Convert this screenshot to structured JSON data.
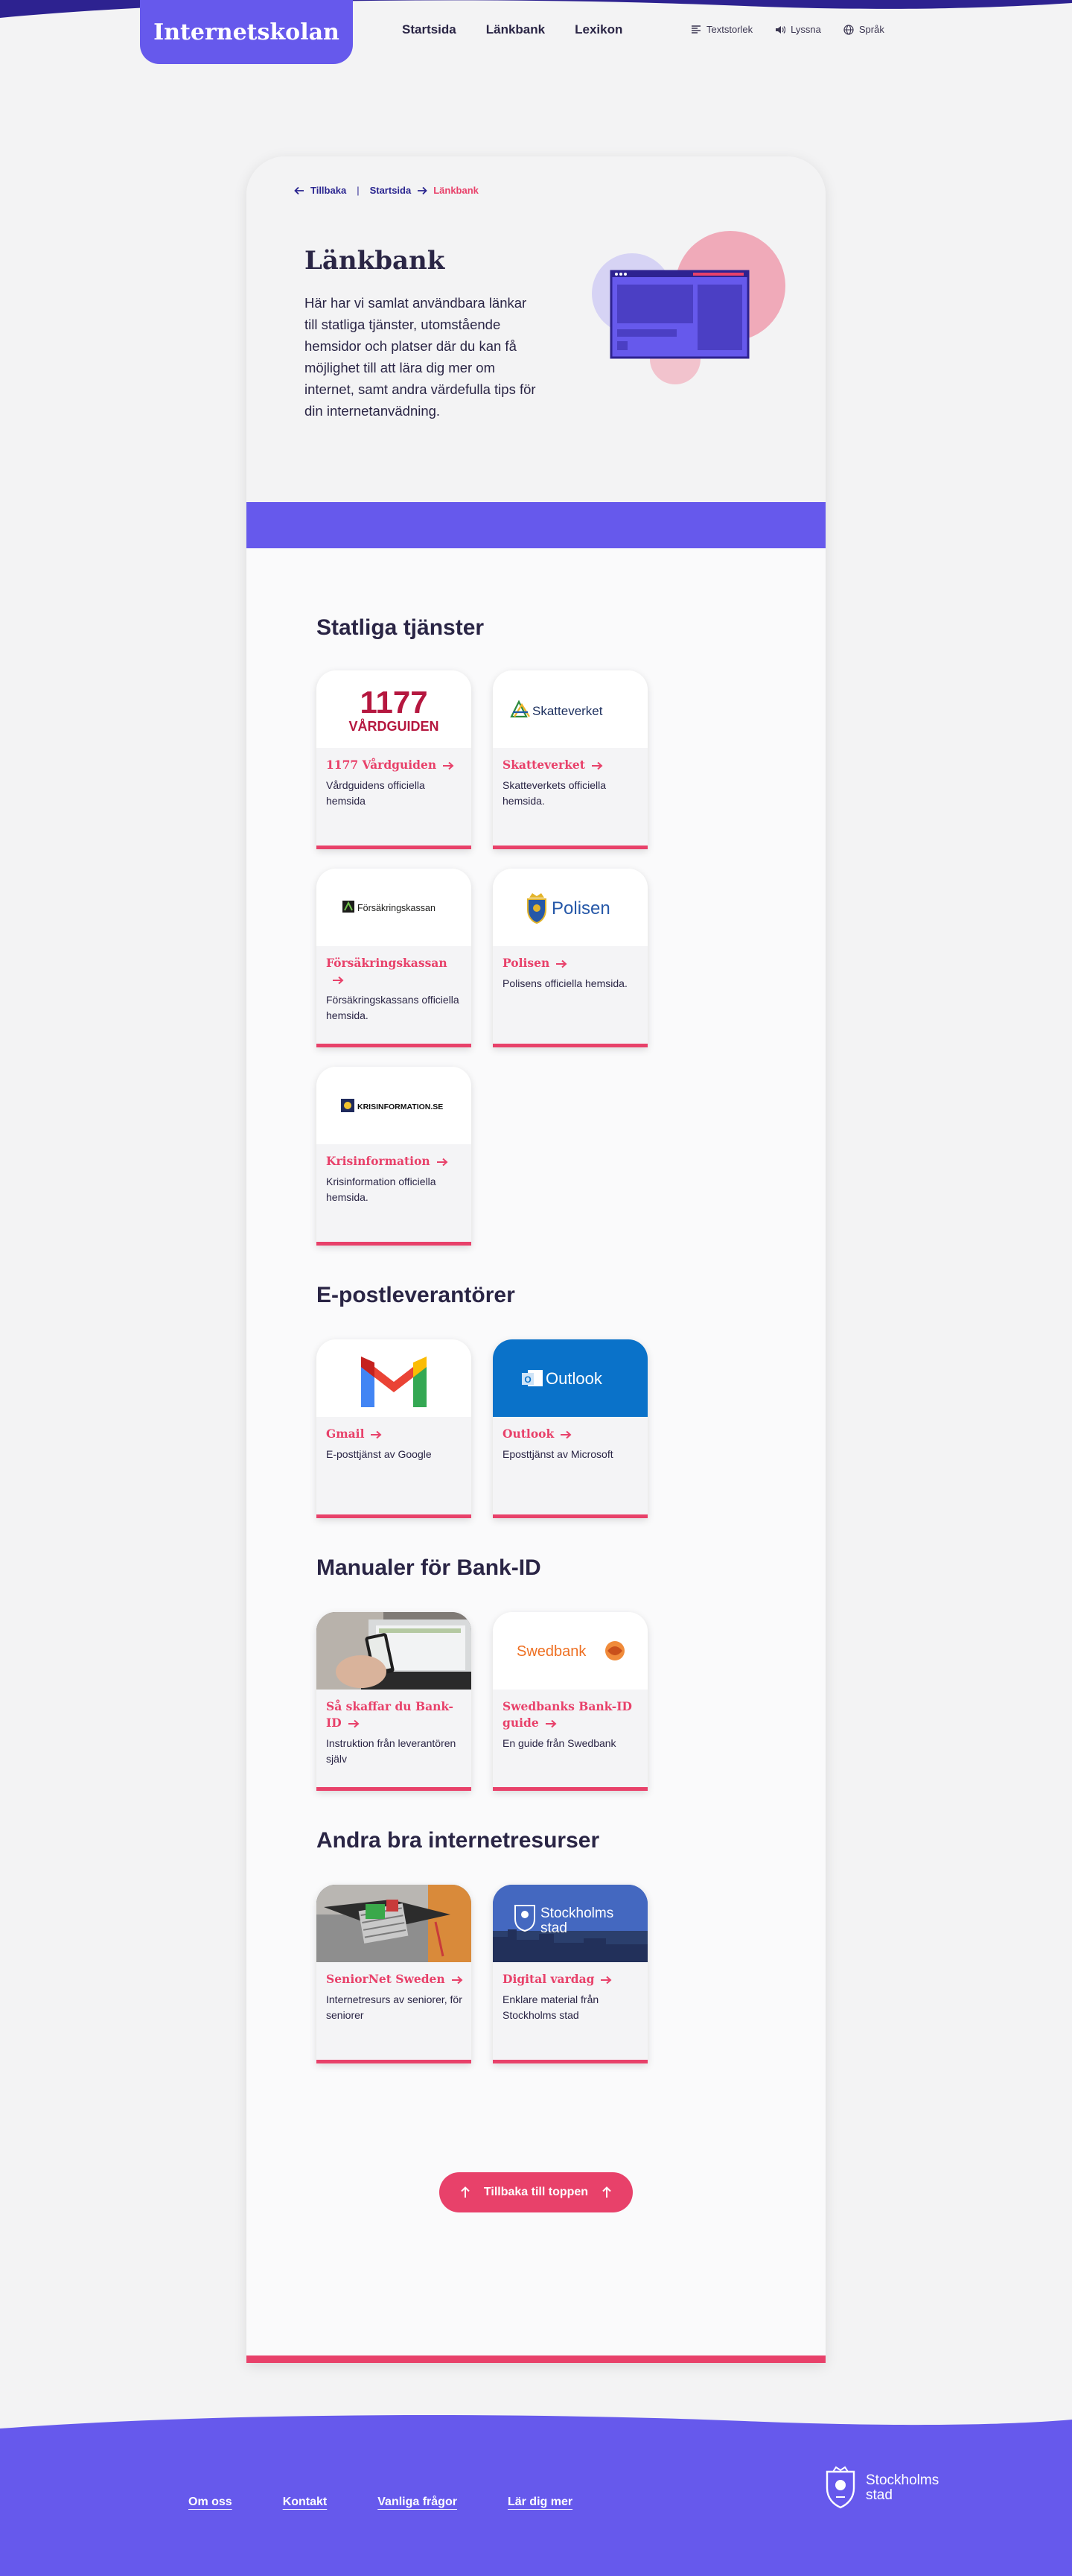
{
  "header": {
    "logo": "Internetskolan",
    "nav": [
      "Startsida",
      "Länkbank",
      "Lexikon"
    ],
    "utils": [
      {
        "label": "Textstorlek",
        "icon": "text-size-icon"
      },
      {
        "label": "Lyssna",
        "icon": "speaker-icon"
      },
      {
        "label": "Språk",
        "icon": "globe-icon"
      }
    ]
  },
  "breadcrumb": {
    "back": "Tillbaka",
    "home": "Startsida",
    "current": "Länkbank"
  },
  "hero": {
    "title": "Länkbank",
    "text": "Här har vi samlat användbara länkar till statliga tjänster, utomstående hemsidor och platser där du kan få möjlighet till att lära dig mer om internet, samt andra värdefulla tips för din internetanvädning."
  },
  "sections": [
    {
      "title": "Statliga tjänster",
      "tiles": [
        {
          "link": "1177 Vårdguiden",
          "desc": "Vårdguidens officiella hemsida",
          "logo_top": "1177",
          "logo_bottom": "VÅRDGUIDEN"
        },
        {
          "link": "Skatteverket",
          "desc": "Skatteverkets officiella hemsida.",
          "logo": "Skatteverket"
        },
        {
          "link": "Försäkringskassan",
          "desc": "Försäkringskassans officiella hemsida.",
          "logo": "Försäkringskassan"
        },
        {
          "link": "Polisen",
          "desc": "Polisens officiella hemsida.",
          "logo": "Polisen"
        },
        {
          "link": "Krisinformation",
          "desc": "Krisinformation officiella hemsida.",
          "logo": "KRISINFORMATION.SE"
        }
      ]
    },
    {
      "title": "E-postleverantörer",
      "tiles": [
        {
          "link": "Gmail",
          "desc": "E-posttjänst av Google"
        },
        {
          "link": "Outlook",
          "desc": "Eposttjänst av Microsoft",
          "logo": "Outlook"
        }
      ]
    },
    {
      "title": "Manualer för Bank-ID",
      "tiles": [
        {
          "link": "Så skaffar du Bank-ID",
          "desc": "Instruktion från leverantören själv"
        },
        {
          "link": "Swedbanks Bank-ID guide",
          "desc": "En guide från Swedbank",
          "logo": "Swedbank"
        }
      ]
    },
    {
      "title": "Andra bra internetresurser",
      "tiles": [
        {
          "link": "SeniorNet Sweden",
          "desc": "Internetresurs av seniorer, för seniorer"
        },
        {
          "link": "Digital vardag",
          "desc": "Enklare material från Stockholms stad",
          "logo": "Stockholms stad"
        }
      ]
    }
  ],
  "back_to_top": "Tillbaka till toppen",
  "footer": {
    "links": [
      "Om oss",
      "Kontakt",
      "Vanliga frågor",
      "Lär dig mer"
    ],
    "logo": "Stockholms stad"
  },
  "colors": {
    "brand_purple": "#6659ec",
    "accent_pink": "#e8416a",
    "text_dark": "#2a2545",
    "background": "#f3f3f4"
  }
}
